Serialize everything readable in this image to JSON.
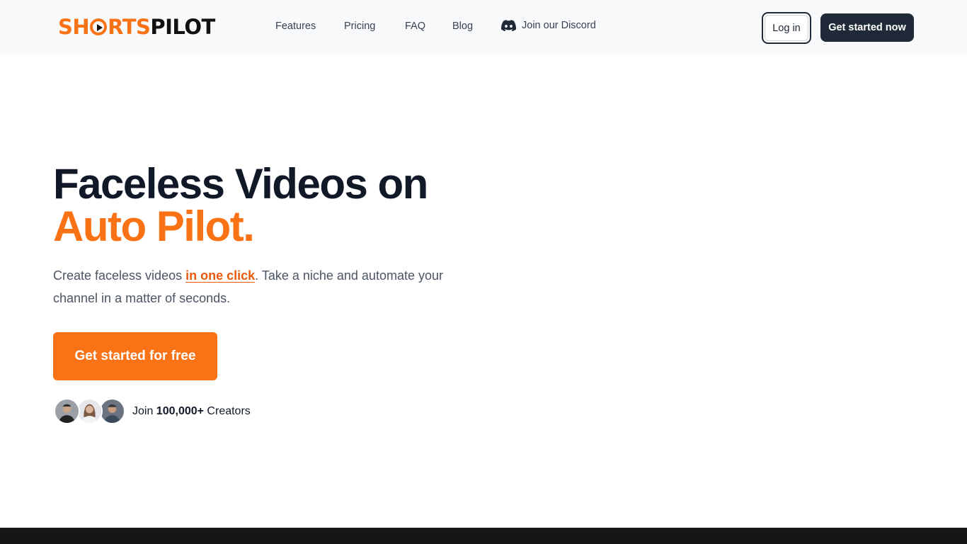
{
  "brand": {
    "part1": "SHORTS",
    "part2": "PILOT",
    "accent": "#f97316",
    "dark": "#1f2937"
  },
  "nav": {
    "features": "Features",
    "pricing": "Pricing",
    "faq": "FAQ",
    "blog": "Blog",
    "discord": "Join our Discord",
    "discord_icon": "discord-icon"
  },
  "header": {
    "login": "Log in",
    "cta": "Get started now"
  },
  "hero": {
    "title_line1": "Faceless Videos on",
    "title_line2": "Auto Pilot.",
    "sub_before": "Create faceless videos ",
    "sub_link": "in one click",
    "sub_after": ". Take a niche and automate your channel in a matter of seconds.",
    "cta": "Get started for free",
    "join_prefix": "Join ",
    "join_count": "100,000+",
    "join_suffix": " Creators"
  }
}
